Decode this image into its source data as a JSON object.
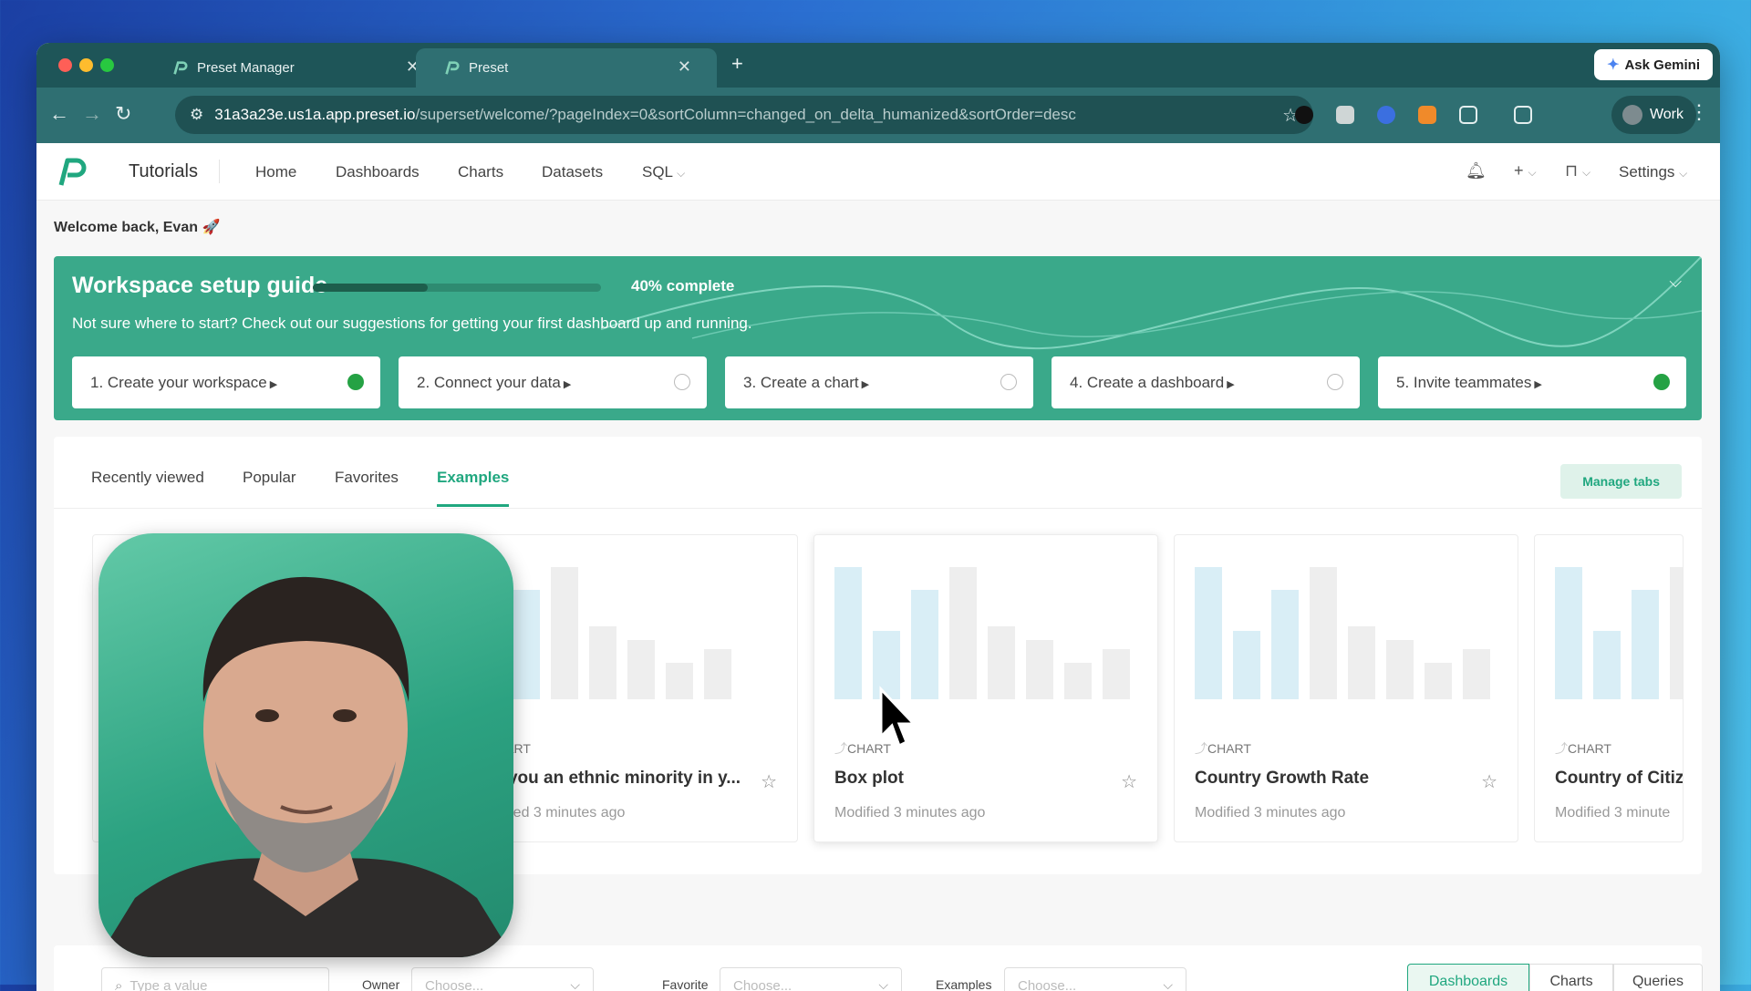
{
  "browser": {
    "tabs": [
      {
        "title": "Preset Manager",
        "active": false
      },
      {
        "title": "Preset",
        "active": true
      }
    ],
    "ask_gemini": "Ask Gemini",
    "url_host": "31a3a23e.us1a.app.preset.io",
    "url_path": "/superset/welcome/?pageIndex=0&sortColumn=changed_on_delta_humanized&sortOrder=desc",
    "profile": "Work"
  },
  "app": {
    "workspace": "Tutorials",
    "nav": [
      "Home",
      "Dashboards",
      "Charts",
      "Datasets",
      "SQL"
    ],
    "settings": "Settings",
    "welcome": "Welcome back, Evan 🚀"
  },
  "guide": {
    "title": "Workspace setup guide",
    "progress": 0.4,
    "progress_label": "40% complete",
    "subtitle": "Not sure where to start? Check out our suggestions for getting your first dashboard up and running.",
    "steps": [
      {
        "label": "1. Create your workspace",
        "done": true
      },
      {
        "label": "2. Connect your data",
        "done": false
      },
      {
        "label": "3. Create a chart",
        "done": false
      },
      {
        "label": "4. Create a dashboard",
        "done": false
      },
      {
        "label": "5. Invite teammates",
        "done": true
      }
    ]
  },
  "home_tabs": [
    "Recently viewed",
    "Popular",
    "Favorites",
    "Examples"
  ],
  "active_tab": "Examples",
  "manage_tabs": "Manage tabs",
  "cards": [
    {
      "type": "CHART",
      "title": "Are you an ethnic minority in y...",
      "modified": "Modified 3 minutes ago"
    },
    {
      "type": "CHART",
      "title": "Box plot",
      "modified": "Modified 3 minutes ago"
    },
    {
      "type": "CHART",
      "title": "Country Growth Rate",
      "modified": "Modified 3 minutes ago"
    },
    {
      "type": "CHART",
      "title": "Country of Citiz",
      "modified": "Modified 3 minute"
    }
  ],
  "filters": {
    "search_placeholder": "Type a value",
    "owner_label": "Owner",
    "owner_placeholder": "Choose...",
    "favorite_label": "Favorite",
    "favorite_placeholder": "Choose...",
    "examples_label": "Examples",
    "examples_placeholder": "Choose..."
  },
  "segments": [
    "Dashboards",
    "Charts",
    "Queries"
  ],
  "colors": {
    "brand": "#20a77f",
    "guide_bg": "#3aa98a",
    "chrome": "#2f6f72"
  }
}
